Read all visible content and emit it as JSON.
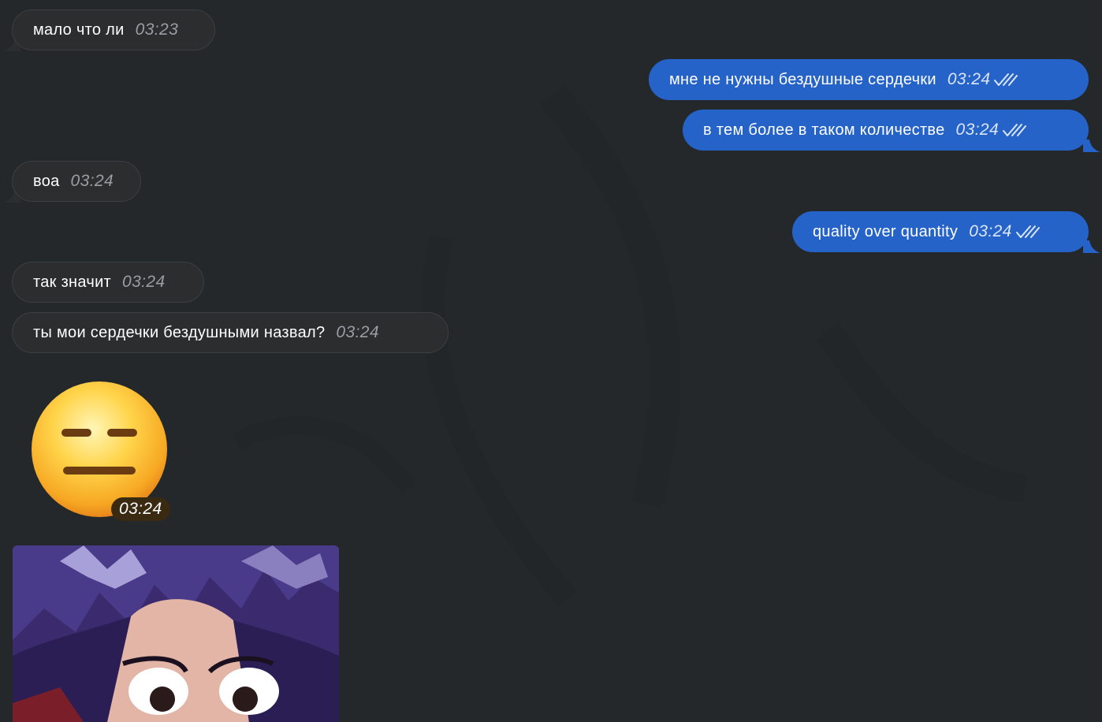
{
  "messages": [
    {
      "direction": "in",
      "text": "мало что ли",
      "time": "03:23"
    },
    {
      "direction": "out",
      "text": "мне не нужны бездушные сердечки",
      "time": "03:24",
      "status": "read"
    },
    {
      "direction": "out",
      "text": "в тем более в таком количестве",
      "time": "03:24",
      "status": "read"
    },
    {
      "direction": "in",
      "text": "воа",
      "time": "03:24"
    },
    {
      "direction": "out",
      "text": "quality over quantity",
      "time": "03:24",
      "status": "read"
    },
    {
      "direction": "in",
      "text": "так значит",
      "time": "03:24"
    },
    {
      "direction": "in",
      "text": "ты мои сердечки бездушными назвал?",
      "time": "03:24"
    }
  ],
  "emoji_message": {
    "icon": "expressionless-face-emoji",
    "time": "03:24"
  },
  "photo_message": {
    "icon": "anime-character-photo"
  },
  "colors": {
    "background": "#25282b",
    "incoming_bubble": "#2b2d2f",
    "outgoing_bubble": "#2563c9"
  }
}
